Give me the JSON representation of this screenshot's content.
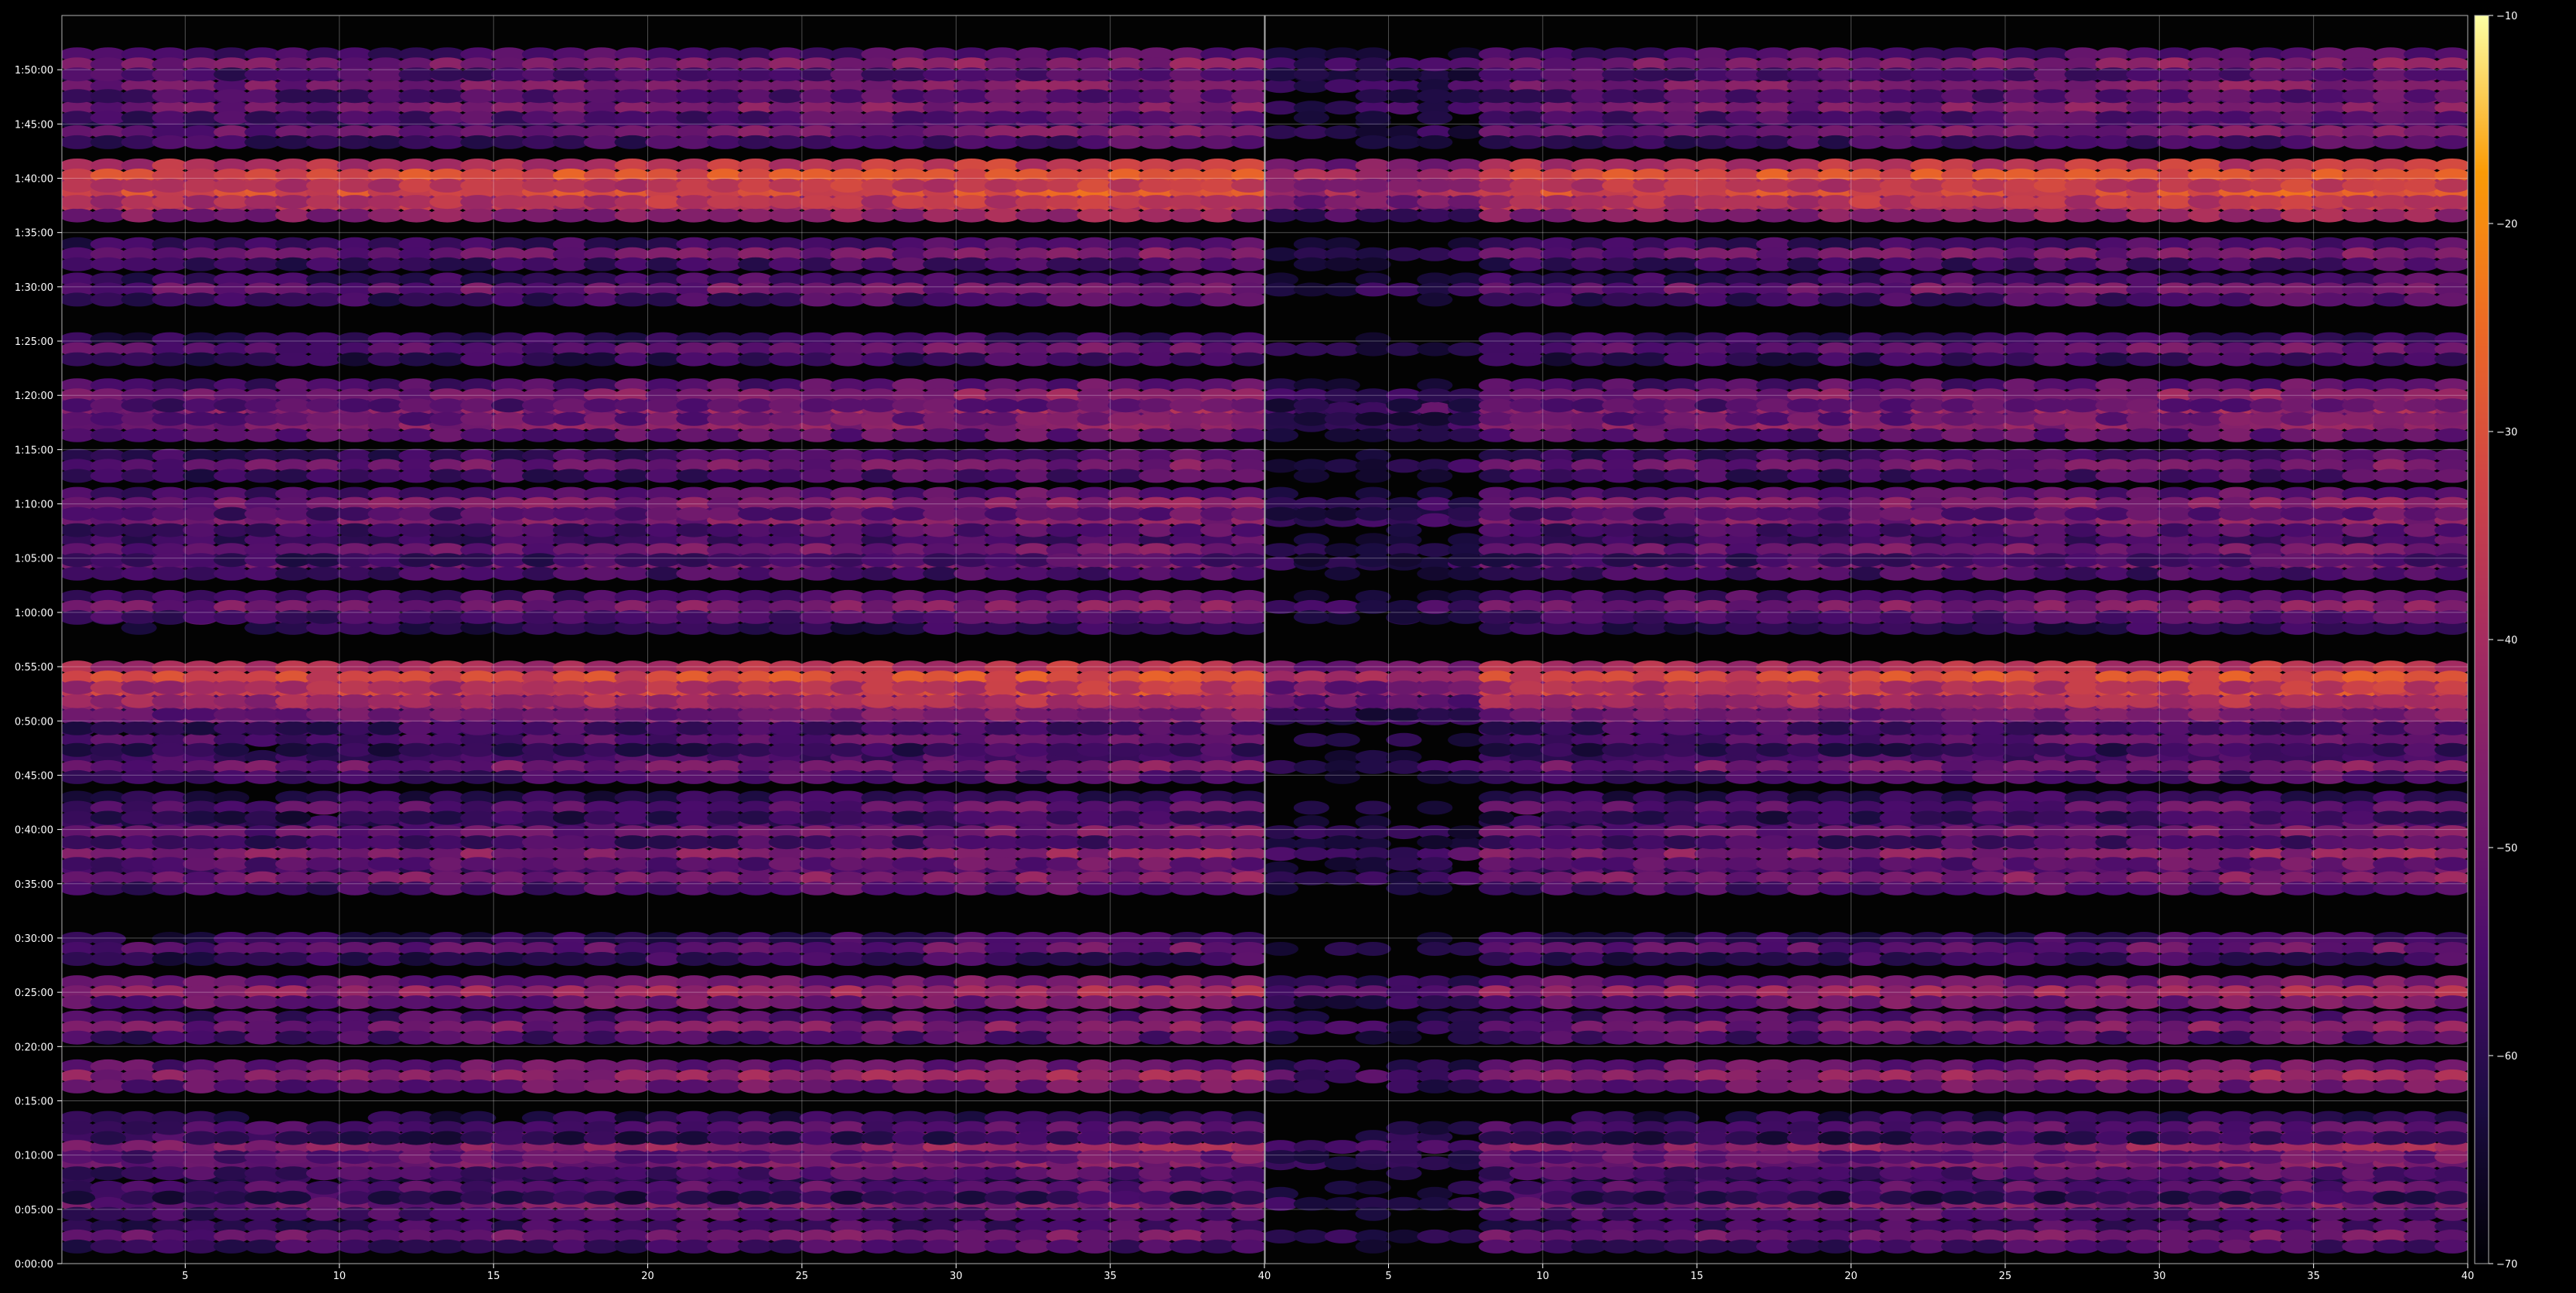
{
  "chart_data": [
    {
      "type": "heatmap",
      "panel": "left",
      "title": "",
      "xlabel": "",
      "ylabel": "",
      "xlim": [
        1,
        40
      ],
      "x_ticks": [
        5,
        10,
        15,
        20,
        25,
        30,
        35,
        40
      ],
      "x_tick_labels": [
        "5",
        "10",
        "15",
        "20",
        "25",
        "30",
        "35",
        "40"
      ],
      "y_unit": "seconds",
      "ylim": [
        0,
        6900
      ],
      "y_ticks": [
        0,
        300,
        600,
        900,
        1200,
        1500,
        1800,
        2100,
        2400,
        2700,
        3000,
        3300,
        3600,
        3900,
        4200,
        4500,
        4800,
        5100,
        5400,
        5700,
        6000,
        6300,
        6600
      ],
      "y_tick_labels": [
        "0:00:00",
        "0:05:00",
        "0:10:00",
        "0:15:00",
        "0:20:00",
        "0:25:00",
        "0:30:00",
        "0:35:00",
        "0:40:00",
        "0:45:00",
        "0:50:00",
        "0:55:00",
        "1:00:00",
        "1:05:00",
        "1:10:00",
        "1:15:00",
        "1:20:00",
        "1:25:00",
        "1:30:00",
        "1:35:00",
        "1:40:00",
        "1:45:00",
        "1:50:00"
      ],
      "grid": true,
      "colormap": "inferno",
      "value_range": [
        -70,
        -10
      ],
      "bands": [
        {
          "time": 150,
          "level": -52
        },
        {
          "time": 330,
          "level": -50
        },
        {
          "time": 420,
          "level": -56
        },
        {
          "time": 555,
          "level": -50
        },
        {
          "time": 645,
          "level": -47
        },
        {
          "time": 750,
          "level": -56
        },
        {
          "time": 1035,
          "level": -46
        },
        {
          "time": 1305,
          "level": -50
        },
        {
          "time": 1500,
          "level": -45
        },
        {
          "time": 1740,
          "level": -54
        },
        {
          "time": 2130,
          "level": -50
        },
        {
          "time": 2265,
          "level": -48
        },
        {
          "time": 2385,
          "level": -52
        },
        {
          "time": 2520,
          "level": -55
        },
        {
          "time": 2745,
          "level": -51
        },
        {
          "time": 2895,
          "level": -55
        },
        {
          "time": 3015,
          "level": -52
        },
        {
          "time": 3090,
          "level": -45
        },
        {
          "time": 3165,
          "level": -36
        },
        {
          "time": 3240,
          "level": -34
        },
        {
          "time": 3570,
          "level": -56
        },
        {
          "time": 3630,
          "level": -50
        },
        {
          "time": 3870,
          "level": -52
        },
        {
          "time": 3945,
          "level": -52
        },
        {
          "time": 4110,
          "level": -50
        },
        {
          "time": 4200,
          "level": -49
        },
        {
          "time": 4410,
          "level": -52
        },
        {
          "time": 4635,
          "level": -48
        },
        {
          "time": 4725,
          "level": -46
        },
        {
          "time": 4800,
          "level": -49
        },
        {
          "time": 5055,
          "level": -54
        },
        {
          "time": 5385,
          "level": -52
        },
        {
          "time": 5580,
          "level": -52
        },
        {
          "time": 5850,
          "level": -40
        },
        {
          "time": 5925,
          "level": -33
        },
        {
          "time": 6015,
          "level": -32
        },
        {
          "time": 6255,
          "level": -52
        },
        {
          "time": 6390,
          "level": -50
        },
        {
          "time": 6510,
          "level": -50
        },
        {
          "time": 6630,
          "level": -50
        }
      ]
    },
    {
      "type": "heatmap",
      "panel": "right",
      "title": "",
      "xlabel": "",
      "ylabel": "",
      "xlim": [
        1,
        40
      ],
      "x_ticks": [
        5,
        10,
        15,
        20,
        25,
        30,
        35,
        40
      ],
      "x_tick_labels": [
        "5",
        "10",
        "15",
        "20",
        "25",
        "30",
        "35",
        "40"
      ],
      "y_unit": "seconds",
      "ylim": [
        0,
        6900
      ],
      "grid": true,
      "colormap": "inferno",
      "value_range": [
        -70,
        -10
      ],
      "bands_same_as": "left"
    }
  ],
  "colorbar": {
    "ticks": [
      -70,
      -60,
      -50,
      -40,
      -30,
      -20,
      -10
    ],
    "tick_labels": [
      "−70",
      "−60",
      "−50",
      "−40",
      "−30",
      "−20",
      "−10"
    ]
  }
}
